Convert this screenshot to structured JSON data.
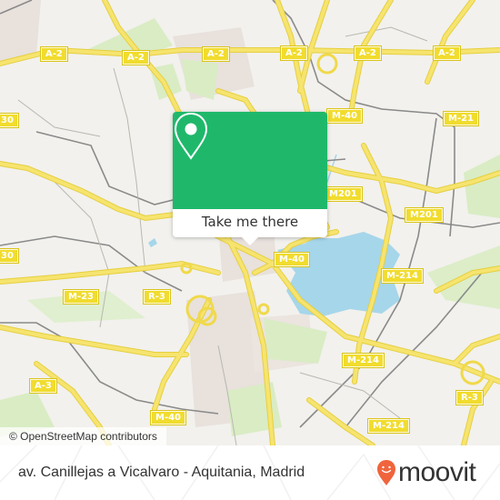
{
  "map": {
    "colors": {
      "background": "#f2f1ed",
      "road": "#f5e06a",
      "road_casing": "#e6cf3f",
      "park": "#d9ecc4",
      "water": "#a6d6ea",
      "rail": "#888888",
      "urban": "#e8e1dc"
    },
    "road_labels": [
      {
        "text": "A-2",
        "id": "a2-1"
      },
      {
        "text": "A-2",
        "id": "a2-2"
      },
      {
        "text": "A-2",
        "id": "a2-3"
      },
      {
        "text": "A-2",
        "id": "a2-4"
      },
      {
        "text": "A-2",
        "id": "a2-5"
      },
      {
        "text": "A-2",
        "id": "a2-6"
      },
      {
        "text": "M-40",
        "id": "m40-1"
      },
      {
        "text": "M-21",
        "id": "m21-1"
      },
      {
        "text": "M201",
        "id": "m201-1"
      },
      {
        "text": "M201",
        "id": "m201-2"
      },
      {
        "text": "M-40",
        "id": "m40-2"
      },
      {
        "text": "M-214",
        "id": "m214-1"
      },
      {
        "text": "M-23",
        "id": "m23-1"
      },
      {
        "text": "R-3",
        "id": "r3-1"
      },
      {
        "text": "M-214",
        "id": "m214-2"
      },
      {
        "text": "A-3",
        "id": "a3-1"
      },
      {
        "text": "R-3",
        "id": "r3-2"
      },
      {
        "text": "M-40",
        "id": "m40-3"
      },
      {
        "text": "M-214",
        "id": "m214-3"
      },
      {
        "text": "30",
        "id": "m30-1"
      },
      {
        "text": "30",
        "id": "m30-2"
      }
    ]
  },
  "popup": {
    "icon": "map-pin-icon",
    "action_label": "Take me there",
    "color": "#1fb86b"
  },
  "attribution": "© OpenStreetMap contributors",
  "footer": {
    "stop_name": "av. Canillejas a Vicalvaro - Aquitania, Madrid",
    "brand": "moovit",
    "brand_color": "#f0643c"
  }
}
